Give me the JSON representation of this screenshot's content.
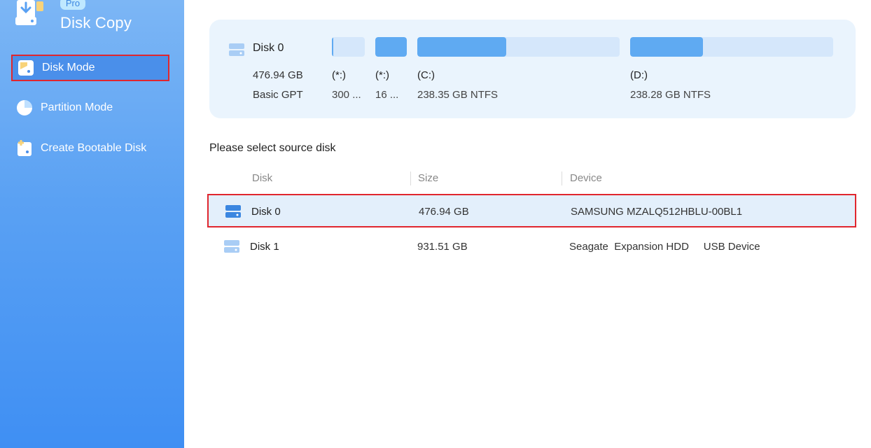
{
  "app": {
    "badge": "Pro",
    "title": "Disk Copy"
  },
  "sidebar": {
    "items": [
      {
        "label": "Disk Mode",
        "icon": "disk-mode-icon",
        "active": true
      },
      {
        "label": "Partition Mode",
        "icon": "pie-chart-icon",
        "active": false
      },
      {
        "label": "Create Bootable Disk",
        "icon": "bootable-disk-icon",
        "active": false
      }
    ]
  },
  "disk_map": {
    "name": "Disk 0",
    "size": "476.94 GB",
    "type": "Basic GPT",
    "partitions": [
      {
        "label": "(*:)",
        "info": "300 ...",
        "used_fraction": 0.05
      },
      {
        "label": "(*:)",
        "info": "16 ...",
        "used_fraction": 1.0
      },
      {
        "label": "(C:)",
        "info": "238.35 GB NTFS",
        "used_fraction": 0.44
      },
      {
        "label": "(D:)",
        "info": "238.28 GB NTFS",
        "used_fraction": 0.36
      }
    ]
  },
  "section_title": "Please select source disk",
  "table": {
    "headers": {
      "disk": "Disk",
      "size": "Size",
      "device": "Device"
    },
    "rows": [
      {
        "disk": "Disk 0",
        "size": "476.94 GB",
        "device": "SAMSUNG MZALQ512HBLU-00BL1",
        "selected": true
      },
      {
        "disk": "Disk 1",
        "size": "931.51 GB",
        "device": "Seagate  Expansion HDD     USB Device",
        "selected": false
      }
    ]
  },
  "colors": {
    "sidebar_top": "#7cb6f5",
    "sidebar_bottom": "#3f8ff3",
    "accent": "#5faaf2",
    "highlight_border": "#e0262e",
    "selected_row": "#e3effb"
  }
}
